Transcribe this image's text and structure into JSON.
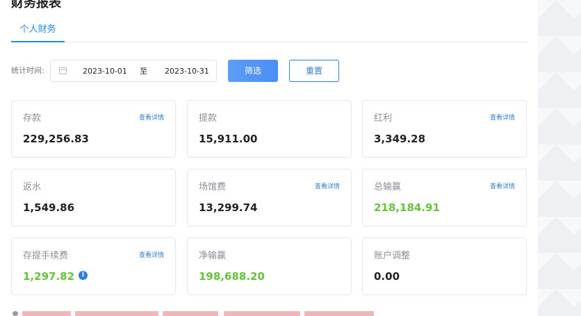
{
  "page": {
    "title": "财务报表"
  },
  "tabs": [
    {
      "label": "个人财务"
    }
  ],
  "filter": {
    "label": "统计时间:",
    "start_date": "2023-10-01",
    "separator": "至",
    "end_date": "2023-10-31",
    "filter_button": "筛选",
    "reset_button": "重置"
  },
  "detail_link": "查看详情",
  "cards": [
    {
      "title": "存款",
      "value": "229,256.83",
      "has_link": true,
      "value_color": "default"
    },
    {
      "title": "提款",
      "value": "15,911.00",
      "has_link": false,
      "value_color": "default"
    },
    {
      "title": "红利",
      "value": "3,349.28",
      "has_link": true,
      "value_color": "default"
    },
    {
      "title": "返水",
      "value": "1,549.86",
      "has_link": false,
      "value_color": "default"
    },
    {
      "title": "场馆费",
      "value": "13,299.74",
      "has_link": true,
      "value_color": "default"
    },
    {
      "title": "总输赢",
      "value": "218,184.91",
      "has_link": true,
      "value_color": "#67c23a"
    },
    {
      "title": "存提手续费",
      "value": "1,297.82",
      "has_link": true,
      "value_color": "#67c23a",
      "info_icon": "info-icon"
    },
    {
      "title": "净输赢",
      "value": "198,688.20",
      "has_link": false,
      "value_color": "#67c23a"
    },
    {
      "title": "账户调整",
      "value": "0.00",
      "has_link": false,
      "value_color": "default"
    }
  ],
  "colors": {
    "accent": "#1e88e5",
    "positive": "#67c23a",
    "link": "#2f7fd8"
  }
}
